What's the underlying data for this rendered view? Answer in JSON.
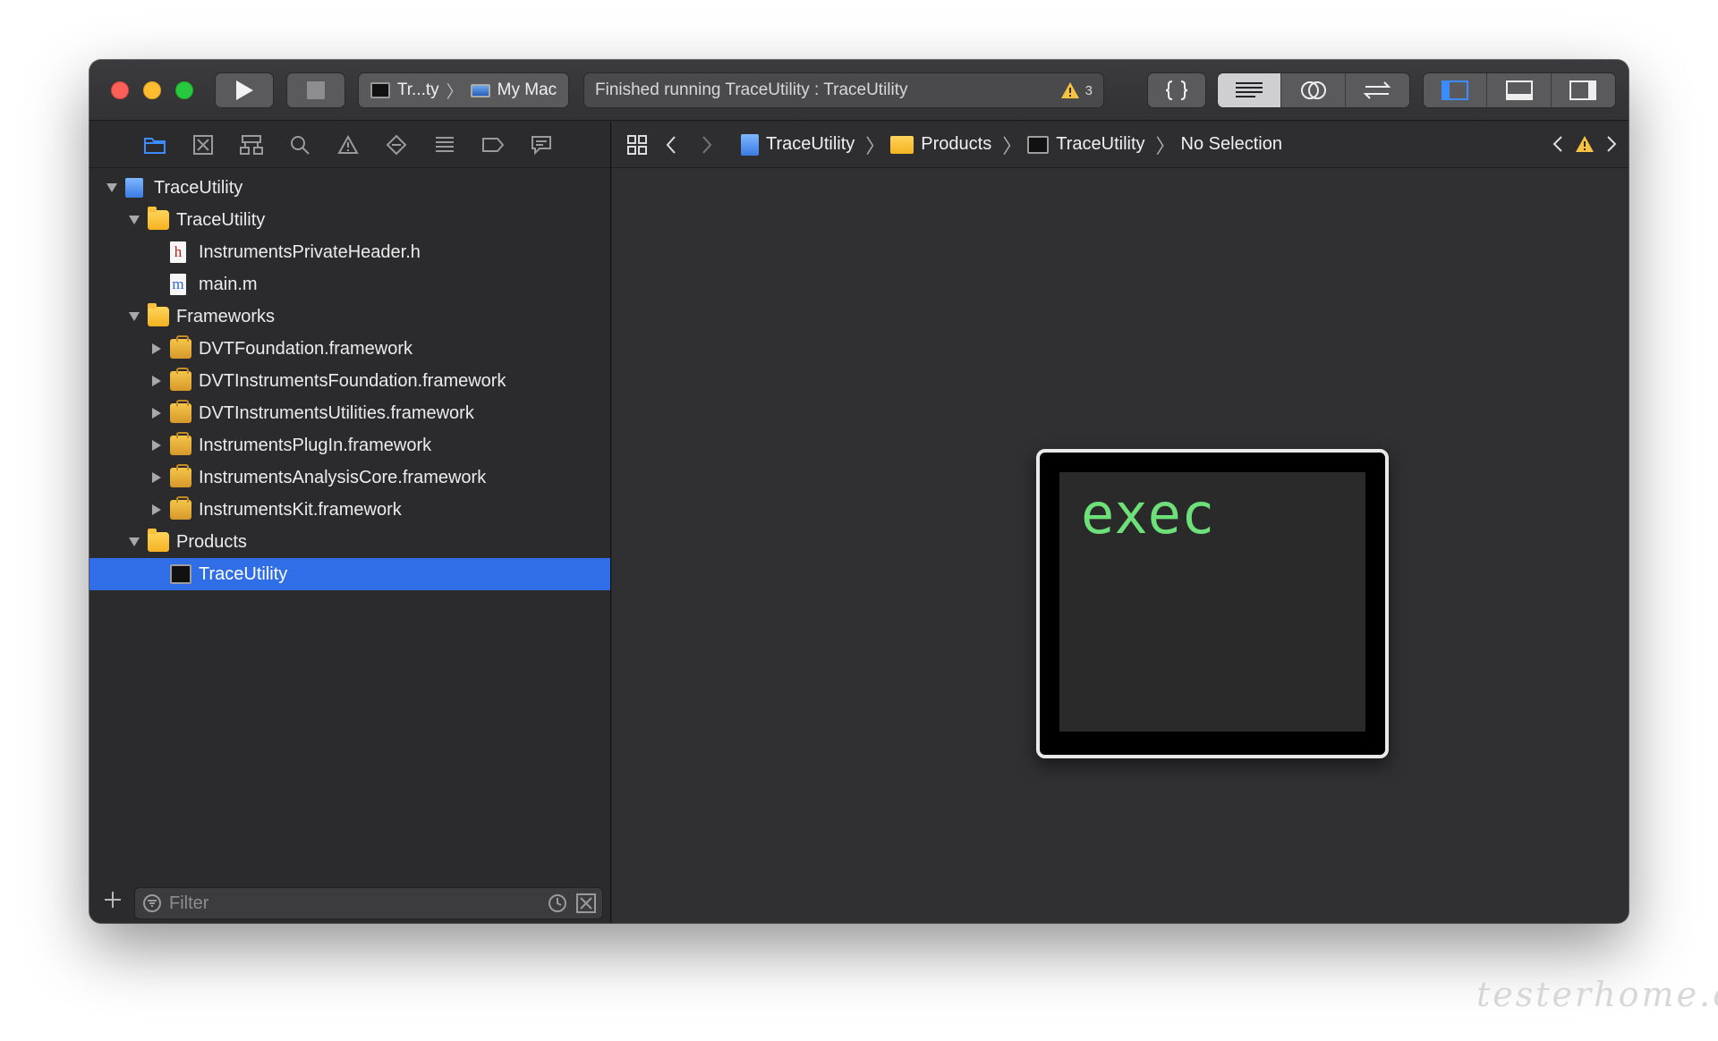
{
  "toolbar": {
    "scheme_target": "Tr...ty",
    "scheme_device": "My Mac",
    "activity_text": "Finished running TraceUtility : TraceUtility",
    "warning_count": "3"
  },
  "navigator": {
    "tree": [
      {
        "label": "TraceUtility",
        "icon": "project-icon",
        "level": 0,
        "expanded": true
      },
      {
        "label": "TraceUtility",
        "icon": "folder-icon",
        "level": 1,
        "expanded": true
      },
      {
        "label": "InstrumentsPrivateHeader.h",
        "icon": "header-file-icon",
        "level": 2
      },
      {
        "label": "main.m",
        "icon": "objc-file-icon",
        "level": 2
      },
      {
        "label": "Frameworks",
        "icon": "folder-icon",
        "level": 1,
        "expanded": true
      },
      {
        "label": "DVTFoundation.framework",
        "icon": "framework-icon",
        "level": 2,
        "expanded": false
      },
      {
        "label": "DVTInstrumentsFoundation.framework",
        "icon": "framework-icon",
        "level": 2,
        "expanded": false
      },
      {
        "label": "DVTInstrumentsUtilities.framework",
        "icon": "framework-icon",
        "level": 2,
        "expanded": false
      },
      {
        "label": "InstrumentsPlugIn.framework",
        "icon": "framework-icon",
        "level": 2,
        "expanded": false
      },
      {
        "label": "InstrumentsAnalysisCore.framework",
        "icon": "framework-icon",
        "level": 2,
        "expanded": false
      },
      {
        "label": "InstrumentsKit.framework",
        "icon": "framework-icon",
        "level": 2,
        "expanded": false
      },
      {
        "label": "Products",
        "icon": "folder-icon",
        "level": 1,
        "expanded": true
      },
      {
        "label": "TraceUtility",
        "icon": "executable-icon",
        "level": 2,
        "selected": true
      }
    ],
    "filter_placeholder": "Filter"
  },
  "jumpbar": {
    "crumbs": [
      "TraceUtility",
      "Products",
      "TraceUtility",
      "No Selection"
    ]
  },
  "editor": {
    "exec_label": "exec"
  },
  "watermark": "testerhome.com",
  "colors": {
    "selection": "#2f6ee6",
    "exec_text": "#6ee07a",
    "folder": "#f4b321",
    "warning": "#f5c242"
  }
}
